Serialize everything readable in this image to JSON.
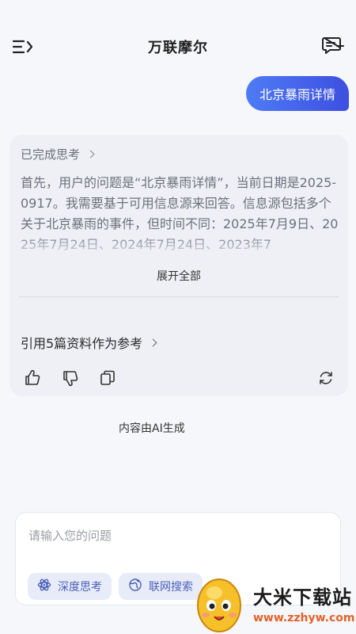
{
  "header": {
    "title": "万联摩尔",
    "menu_icon": "menu-icon",
    "new_chat_icon": "new-chat-icon"
  },
  "user_message": "北京暴雨详情",
  "answer": {
    "thinking_label": "已完成思考",
    "thinking_text": "首先，用户的问题是“北京暴雨详情”，当前日期是2025-0917。我需要基于可用信息源来回答。信息源包括多个关于北京暴雨的事件，但时间不同：2025年7月9日、2025年7月24日、2024年7月24日、2023年7",
    "expand_label": "展开全部",
    "references_label": "引用5篇资料作为参考",
    "actions": [
      "thumbs-up-icon",
      "thumbs-down-icon",
      "copy-icon",
      "refresh-icon"
    ]
  },
  "ai_note": "内容由AI生成",
  "input": {
    "placeholder": "请输入您的问题",
    "chips": [
      {
        "label": "深度思考",
        "icon": "atom-icon"
      },
      {
        "label": "联网搜索",
        "icon": "globe-icon"
      }
    ]
  },
  "watermark": {
    "text": "大米下载站",
    "url": "www.zzhyw.com"
  },
  "colors": {
    "accent": "#4361ee",
    "bubble_start": "#4f7bf6",
    "bubble_end": "#3d4fe0",
    "card_bg": "#eef0f5",
    "watermark_url": "#e2622a"
  }
}
